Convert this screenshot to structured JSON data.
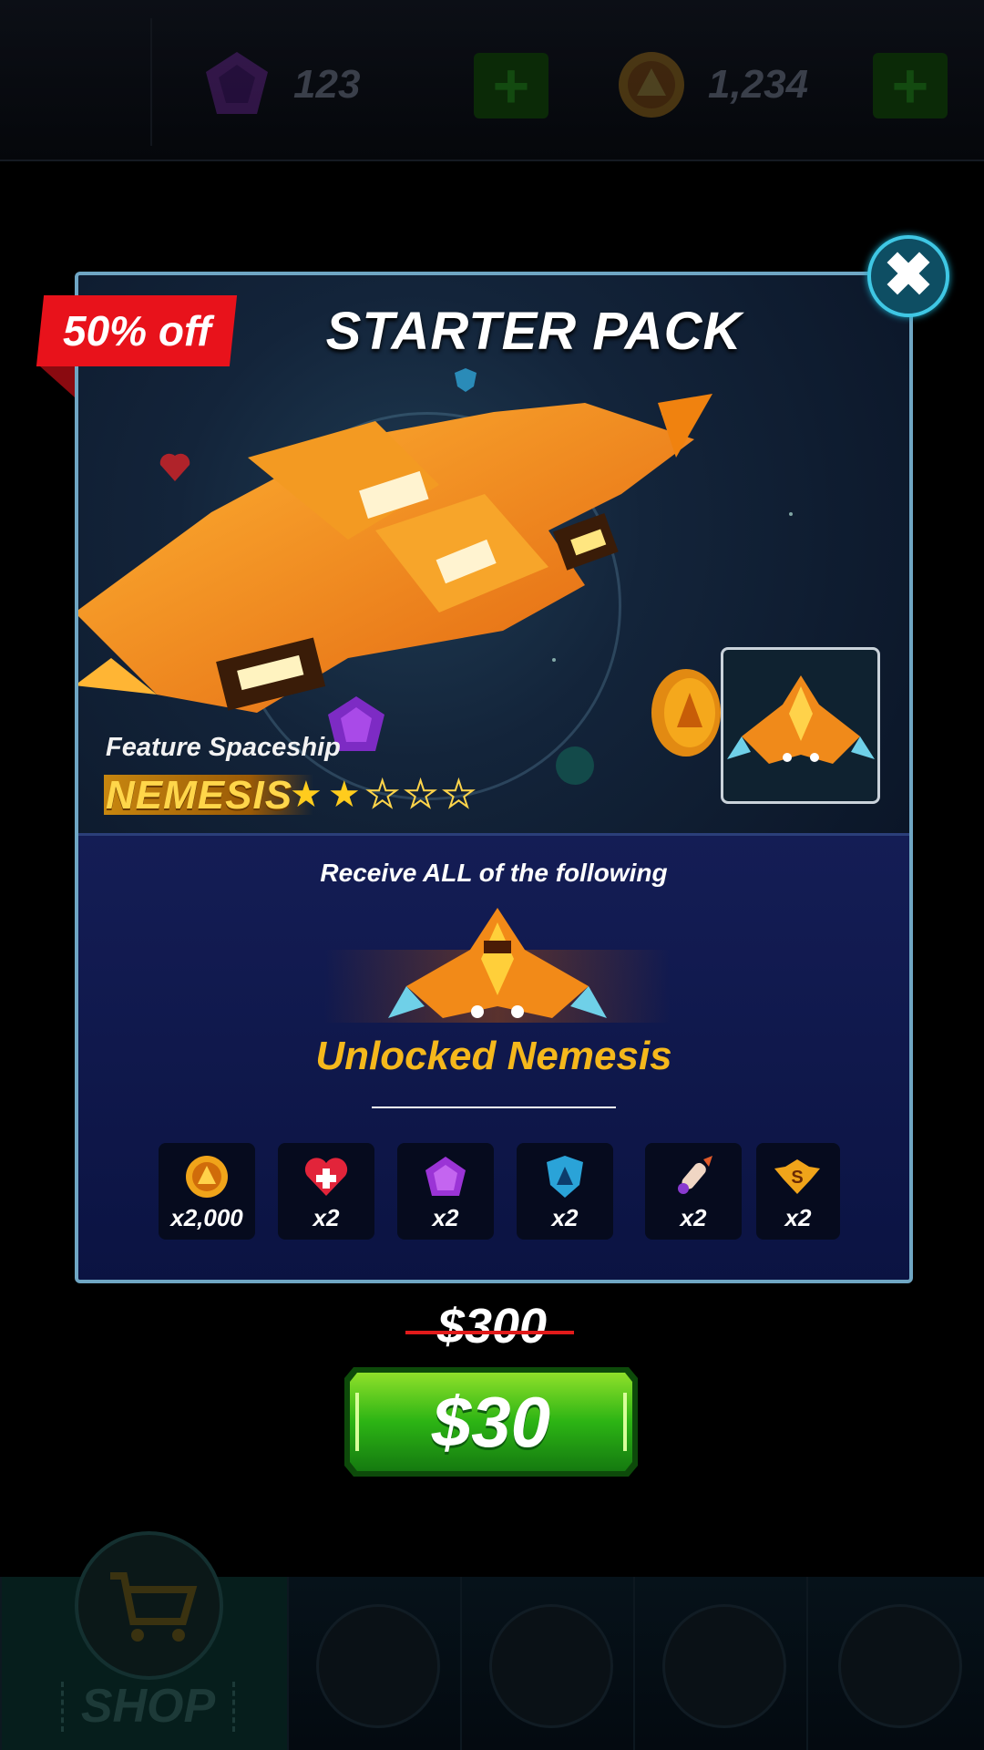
{
  "topbar": {
    "gems": {
      "amount": "123",
      "icon": "gem-icon",
      "add_label": "+"
    },
    "coins": {
      "amount": "1,234",
      "icon": "coin-icon",
      "add_label": "+"
    }
  },
  "dialog": {
    "discount_label": "50% off",
    "title": "STARTER PACK",
    "feature_label": "Feature Spaceship",
    "ship_name": "NEMESIS",
    "rating": {
      "value": 2,
      "max": 5
    },
    "receive_label": "Receive ALL of the following",
    "unlocked_label": "Unlocked Nemesis",
    "items": [
      {
        "icon": "coin-icon",
        "qty": "x2,000"
      },
      {
        "icon": "heart-icon",
        "qty": "x2"
      },
      {
        "icon": "gem-icon",
        "qty": "x2"
      },
      {
        "icon": "shield-icon",
        "qty": "x2"
      },
      {
        "icon": "missile-icon",
        "qty": "x2"
      },
      {
        "icon": "s-badge-icon",
        "qty": "x2"
      }
    ],
    "close_label": "✖"
  },
  "purchase": {
    "original_price": "$300",
    "price": "$30"
  },
  "bottomnav": {
    "shop_label": "SHOP",
    "tabs": [
      "cart-icon",
      "spaceship-icon",
      "play-icon",
      "target-icon",
      "upgrade-icon"
    ]
  },
  "colors": {
    "accent_gold": "#f5b81c",
    "discount_red": "#e8121b",
    "buy_green": "#2fbf17",
    "frame_blue": "#6fa6c4"
  }
}
